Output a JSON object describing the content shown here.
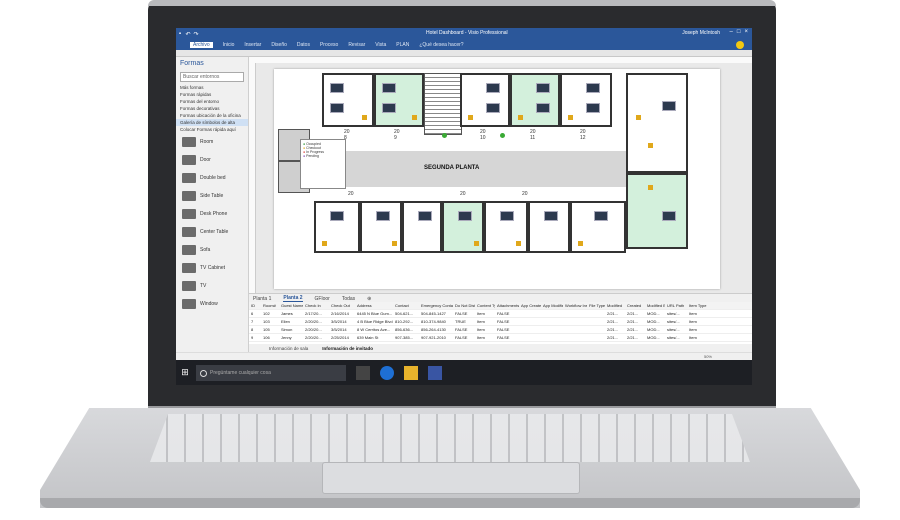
{
  "window": {
    "title": "Hotel Dashboard - Visio Professional",
    "user": "Joseph McIntosh"
  },
  "ribbon": {
    "tabs": [
      "Archivo",
      "Inicio",
      "Insertar",
      "Diseño",
      "Datos",
      "Proceso",
      "Revisar",
      "Vista",
      "PLAN"
    ],
    "tell_me": "¿Qué desea hacer?",
    "accent": "#2b579a"
  },
  "shapes_pane": {
    "header": "Formas",
    "search": "Buscar entornos",
    "links": [
      "Más formas",
      "Formas rápidas",
      "Formas del entorno",
      "Formas decorativas",
      "Formas ubicación de la oficina",
      "Galería de símbolos de alta",
      "Colocar Formas rápida aquí"
    ],
    "items": [
      "Room",
      "Door",
      "Double bed",
      "Side Table",
      "Desk Phone",
      "Center Table",
      "Sofa",
      "TV Cabinet",
      "TV",
      "Window"
    ]
  },
  "floor_plan": {
    "label": "SEGUNDA PLANTA",
    "top_numbers": [
      "20",
      "8",
      "20",
      "9",
      "20",
      "10",
      "20",
      "11",
      "20",
      "12"
    ],
    "bottom_numbers": [
      "20",
      "20",
      "20"
    ],
    "legend": [
      "Occupied",
      "Checkout",
      "In Progress",
      "Pending"
    ],
    "legend_colors": [
      "#1e8f2b",
      "#e0a81b",
      "#d9342b",
      "#7a3fb0"
    ]
  },
  "page_tabs": [
    "Planta 1",
    "Planta 2",
    "GFloor",
    "Todas"
  ],
  "data_grid": {
    "headers": [
      "ID",
      "Room#",
      "Guest Name",
      "Check In",
      "Check Out",
      "Address",
      "Contact",
      "Emergency Contact",
      "Do Not Disturb",
      "Content Type",
      "Attachments",
      "App Created By",
      "App Modified By",
      "Workflow Instance ID",
      "File Type",
      "Modified",
      "Created",
      "Modified By",
      "URL Path",
      "Item Type"
    ],
    "rows": [
      [
        "6",
        "102",
        "James",
        "2/17/20...",
        "2/16/2014",
        "6445 N Blue Gum...",
        "504-621...",
        "504-845-1427",
        "FALSE",
        "Item",
        "FALSE",
        "",
        "",
        "",
        "",
        "2/21...",
        "2/21...",
        "MOD...",
        "sites/...",
        "Item"
      ],
      [
        "7",
        "103",
        "Ellen",
        "2/20/20...",
        "3/5/2014",
        "4 B Blue Ridge Blvd",
        "810-292...",
        "810-374-9840",
        "TRUE",
        "Item",
        "FALSE",
        "",
        "",
        "",
        "",
        "2/21...",
        "2/21...",
        "MOD...",
        "sites/...",
        "Item"
      ],
      [
        "8",
        "105",
        "Simon",
        "2/20/20...",
        "3/5/2014",
        "8 W Cerritos Ave...",
        "856-636...",
        "856-264-4130",
        "FALSE",
        "Item",
        "FALSE",
        "",
        "",
        "",
        "",
        "2/21...",
        "2/21...",
        "MOD...",
        "sites/...",
        "Item"
      ],
      [
        "9",
        "106",
        "Jenny",
        "2/20/20...",
        "2/25/2014",
        "639 Main St",
        "907-385...",
        "907-921-2010",
        "FALSE",
        "Item",
        "FALSE",
        "",
        "",
        "",
        "",
        "2/21...",
        "2/21...",
        "MOD...",
        "sites/...",
        "Item"
      ]
    ]
  },
  "grid_tabs": [
    "Información de sala",
    "Información de invitado"
  ],
  "zoom": "50%",
  "taskbar": {
    "search_placeholder": "Pregúntame cualquier cosa"
  }
}
